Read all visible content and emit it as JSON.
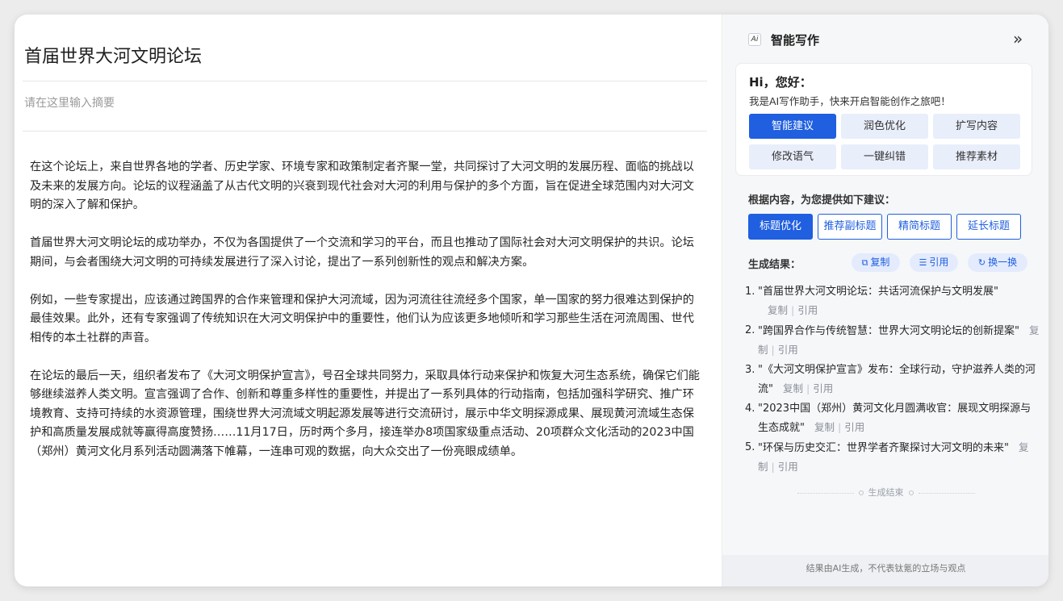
{
  "editor": {
    "title": "首届世界大河文明论坛",
    "abstract_placeholder": "请在这里输入摘要",
    "paragraphs": [
      "在这个论坛上，来自世界各地的学者、历史学家、环境专家和政策制定者齐聚一堂，共同探讨了大河文明的发展历程、面临的挑战以及未来的发展方向。论坛的议程涵盖了从古代文明的兴衰到现代社会对大河的利用与保护的多个方面，旨在促进全球范围内对大河文明的深入了解和保护。",
      "首届世界大河文明论坛的成功举办，不仅为各国提供了一个交流和学习的平台，而且也推动了国际社会对大河文明保护的共识。论坛期间，与会者围绕大河文明的可持续发展进行了深入讨论，提出了一系列创新性的观点和解决方案。",
      "例如，一些专家提出，应该通过跨国界的合作来管理和保护大河流域，因为河流往往流经多个国家，单一国家的努力很难达到保护的最佳效果。此外，还有专家强调了传统知识在大河文明保护中的重要性，他们认为应该更多地倾听和学习那些生活在河流周围、世代相传的本土社群的声音。",
      "在论坛的最后一天，组织者发布了《大河文明保护宣言》，号召全球共同努力，采取具体行动来保护和恢复大河生态系统，确保它们能够继续滋养人类文明。宣言强调了合作、创新和尊重多样性的重要性，并提出了一系列具体的行动指南，包括加强科学研究、推广环境教育、支持可持续的水资源管理，围绕世界大河流域文明起源发展等进行交流研讨，展示中华文明探源成果、展现黄河流域生态保护和高质量发展成就等赢得高度赞扬……11月17日，历时两个多月，接连举办8项国家级重点活动、20项群众文化活动的2023中国（郑州）黄河文化月系列活动圆满落下帷幕，一连串可观的数据，向大众交出了一份亮眼成绩单。"
    ]
  },
  "panel": {
    "logo_text": "Ai",
    "title": "智能写作",
    "collapse_glyph": "»",
    "greeting": "Hi，您好：",
    "intro": "我是AI写作助手，快来开启智能创作之旅吧！",
    "buttons": [
      "智能建议",
      "润色优化",
      "扩写内容",
      "修改语气",
      "一键纠错",
      "推荐素材"
    ],
    "suggest_label": "根据内容，为您提供如下建议：",
    "chips": [
      "标题优化",
      "推荐副标题",
      "精简标题",
      "延长标题"
    ],
    "result_label": "生成结果：",
    "pills": {
      "copy": "复制",
      "cite": "引用",
      "refresh": "换一换"
    },
    "results": [
      "\"首届世界大河文明论坛：共话河流保护与文明发展\"",
      "\"跨国界合作与传统智慧：世界大河文明论坛的创新提案\"",
      "\"《大河文明保护宣言》发布：全球行动，守护滋养人类的河流\"",
      "\"2023中国（郑州）黄河文化月圆满收官：展现文明探源与生态成就\"",
      "\"环保与历史交汇：世界学者齐聚探讨大河文明的未来\""
    ],
    "result_copy": "复制",
    "result_cite": "引用",
    "end_text": "生成结束",
    "footer": "结果由AI生成，不代表钛氪的立场与观点",
    "accent_color": "#1f5fe0"
  }
}
